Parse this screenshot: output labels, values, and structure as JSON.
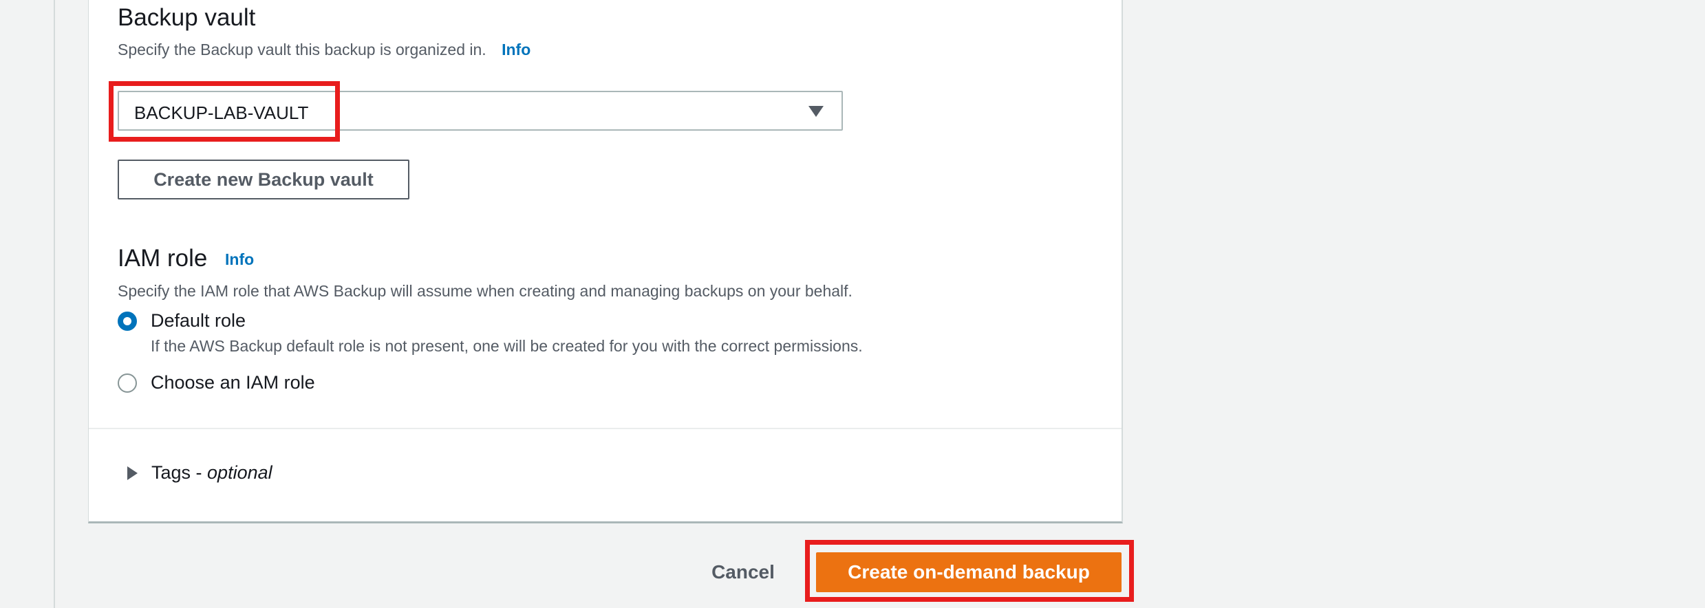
{
  "colors": {
    "accent": "#0073bb",
    "primary_button": "#ec7211",
    "highlight": "#e81d1d",
    "page_background": "#f2f3f3"
  },
  "backup_vault": {
    "title": "Backup vault",
    "description": "Specify the Backup vault this backup is organized in.",
    "info_label": "Info",
    "select": {
      "selected_value": "BACKUP-LAB-VAULT",
      "icon": "caret-down-icon"
    },
    "create_button_label": "Create new Backup vault"
  },
  "iam_role": {
    "title": "IAM role",
    "info_label": "Info",
    "description": "Specify the IAM role that AWS Backup will assume when creating and managing backups on your behalf.",
    "options": [
      {
        "label": "Default role",
        "description": "If the AWS Backup default role is not present, one will be created for you with the correct permissions.",
        "selected": true
      },
      {
        "label": "Choose an IAM role",
        "selected": false
      }
    ]
  },
  "tags": {
    "label": "Tags - ",
    "optional": "optional",
    "icon": "caret-right-icon"
  },
  "footer": {
    "cancel_label": "Cancel",
    "submit_label": "Create on-demand backup"
  }
}
